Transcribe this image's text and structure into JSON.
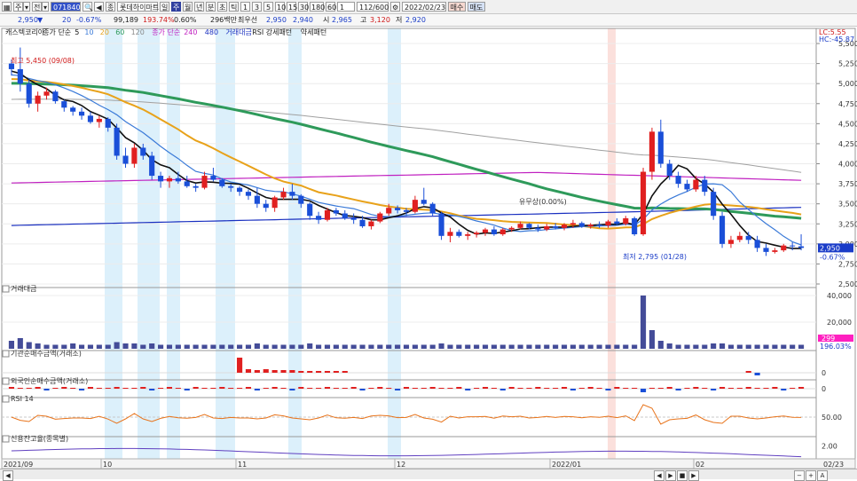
{
  "toolbar": {
    "items": [
      {
        "name": "layout-grid-icon",
        "label": "▦"
      },
      {
        "name": "period-select",
        "label": "주",
        "dropdown": true
      },
      {
        "name": "market-select",
        "label": "전",
        "dropdown": true
      },
      {
        "name": "stock-code-field",
        "label": "071840"
      },
      {
        "name": "search-icon",
        "label": "🔍"
      },
      {
        "name": "prev-stock-button",
        "label": "◀"
      },
      {
        "name": "stock-icon",
        "label": "종"
      },
      {
        "name": "stock-name-field",
        "label": "롯데하이마트"
      },
      {
        "name": "interval-day-button",
        "label": "일"
      },
      {
        "name": "interval-week-button",
        "label": "주"
      },
      {
        "name": "interval-month-button",
        "label": "월"
      },
      {
        "name": "interval-year-button",
        "label": "년"
      },
      {
        "name": "interval-minute-button",
        "label": "분"
      },
      {
        "name": "interval-second-button",
        "label": "초"
      },
      {
        "name": "interval-tick-button",
        "label": "틱"
      },
      {
        "name": "unit-1-button",
        "label": "1"
      },
      {
        "name": "unit-3-button",
        "label": "3"
      },
      {
        "name": "unit-5-button",
        "label": "5"
      },
      {
        "name": "unit-10-button",
        "label": "10"
      },
      {
        "name": "unit-15-button",
        "label": "15"
      },
      {
        "name": "unit-30-button",
        "label": "30"
      },
      {
        "name": "unit-180-button",
        "label": "180"
      },
      {
        "name": "unit-60-button",
        "label": "60"
      },
      {
        "name": "custom-unit-field",
        "label": "1"
      },
      {
        "name": "bar-count-field",
        "label": "112/600"
      },
      {
        "name": "settings-icon",
        "label": "⚙"
      },
      {
        "name": "date-field",
        "label": "2022/02/23"
      },
      {
        "name": "buy-button",
        "label": "매수"
      },
      {
        "name": "sell-button",
        "label": "매도"
      }
    ]
  },
  "quote": {
    "price": "2,950",
    "change_arrow": "▼",
    "change": "20",
    "change_pct": "-0.67%",
    "volume": "99,189",
    "volume_ratio": "193.74%",
    "turnover": "0.60%",
    "market_cap": "296백만",
    "best_bid_label": "최우선",
    "best_ask": "2,950",
    "best_bid": "2,940",
    "open_label": "시",
    "open": "2,965",
    "high_label": "고",
    "high": "3,120",
    "low_label": "저",
    "low": "2,920"
  },
  "legend": {
    "price": "캐스텍코리아",
    "ma_label": "종가 단순",
    "ma_5": "5",
    "ma_10": "10",
    "ma_20": "20",
    "ma_60": "60",
    "ma_120": "120",
    "ma2_label": "종가 단순",
    "ma_240": "240",
    "ma_480": "480",
    "volume": "거래대금",
    "rsi": "RSI 강세패턴",
    "rsi2": "약세패턴"
  },
  "annotations": {
    "high": "최고 5,450 (09/08)",
    "low": "최저 2,795 (01/28)",
    "event": "유무상(0.00%)",
    "lc_label": "LC:5.55",
    "hc_label": "HC:-45.87",
    "last_price": "2,950",
    "last_change": "-0.67%",
    "vol_last": "299",
    "vol_ratio": "196.03%"
  },
  "panes": {
    "volume": "거래대금",
    "inst": "기관순매수금액(거래소)",
    "foreign": "외국인순매수금액(거래소)",
    "rsi": "RSI 14",
    "credit": "신용잔고율(종목별)"
  },
  "axes": {
    "price_ticks": [
      "5,500",
      "5,250",
      "5,000",
      "4,750",
      "4,500",
      "4,250",
      "4,000",
      "3,750",
      "3,500",
      "3,250",
      "3,000",
      "2,750",
      "2,500"
    ],
    "volume_ticks": [
      "40,000",
      "20,000"
    ],
    "inst_ticks": [
      "0"
    ],
    "foreign_ticks": [
      "0"
    ],
    "rsi_ticks": [
      "50.00"
    ],
    "credit_ticks": [
      "2.00"
    ],
    "date_labels": [
      "2021/09",
      "10",
      "11",
      "12",
      "2022/01",
      "02",
      "02/23"
    ]
  },
  "chart_data": {
    "type": "candlestick",
    "ylim": [
      2500,
      5600
    ],
    "candles": [
      [
        5250,
        5300,
        5100,
        5180
      ],
      [
        5180,
        5450,
        4900,
        5000
      ],
      [
        5000,
        5050,
        4700,
        4750
      ],
      [
        4750,
        4900,
        4650,
        4850
      ],
      [
        4850,
        4950,
        4800,
        4900
      ],
      [
        4900,
        4920,
        4750,
        4780
      ],
      [
        4780,
        4800,
        4650,
        4700
      ],
      [
        4700,
        4720,
        4600,
        4650
      ],
      [
        4650,
        4700,
        4550,
        4600
      ],
      [
        4600,
        4650,
        4500,
        4520
      ],
      [
        4520,
        4600,
        4450,
        4560
      ],
      [
        4560,
        4580,
        4400,
        4450
      ],
      [
        4450,
        4500,
        4050,
        4100
      ],
      [
        4100,
        4200,
        3950,
        4000
      ],
      [
        4000,
        4250,
        3950,
        4200
      ],
      [
        4200,
        4250,
        4050,
        4100
      ],
      [
        4100,
        4150,
        3800,
        3850
      ],
      [
        3850,
        3900,
        3700,
        3780
      ],
      [
        3780,
        3850,
        3700,
        3820
      ],
      [
        3820,
        3900,
        3750,
        3780
      ],
      [
        3780,
        3850,
        3700,
        3720
      ],
      [
        3720,
        3750,
        3650,
        3700
      ],
      [
        3700,
        3900,
        3680,
        3850
      ],
      [
        3850,
        3950,
        3780,
        3800
      ],
      [
        3800,
        3820,
        3700,
        3720
      ],
      [
        3720,
        3750,
        3650,
        3700
      ],
      [
        3700,
        3720,
        3600,
        3650
      ],
      [
        3650,
        3680,
        3550,
        3600
      ],
      [
        3600,
        3700,
        3450,
        3500
      ],
      [
        3500,
        3550,
        3400,
        3450
      ],
      [
        3450,
        3600,
        3400,
        3580
      ],
      [
        3580,
        3700,
        3550,
        3650
      ],
      [
        3650,
        3750,
        3550,
        3600
      ],
      [
        3600,
        3620,
        3450,
        3500
      ],
      [
        3500,
        3520,
        3300,
        3350
      ],
      [
        3350,
        3400,
        3250,
        3300
      ],
      [
        3300,
        3450,
        3280,
        3420
      ],
      [
        3420,
        3450,
        3350,
        3380
      ],
      [
        3380,
        3420,
        3300,
        3320
      ],
      [
        3320,
        3380,
        3250,
        3300
      ],
      [
        3300,
        3350,
        3200,
        3220
      ],
      [
        3220,
        3300,
        3180,
        3280
      ],
      [
        3280,
        3400,
        3260,
        3380
      ],
      [
        3380,
        3500,
        3350,
        3450
      ],
      [
        3450,
        3480,
        3380,
        3420
      ],
      [
        3420,
        3450,
        3350,
        3400
      ],
      [
        3400,
        3600,
        3380,
        3550
      ],
      [
        3550,
        3700,
        3480,
        3500
      ],
      [
        3500,
        3520,
        3350,
        3380
      ],
      [
        3380,
        3400,
        3050,
        3100
      ],
      [
        3100,
        3200,
        3020,
        3150
      ],
      [
        3150,
        3180,
        3080,
        3100
      ],
      [
        3100,
        3150,
        3050,
        3120
      ],
      [
        3120,
        3160,
        3080,
        3140
      ],
      [
        3140,
        3200,
        3100,
        3180
      ],
      [
        3180,
        3220,
        3100,
        3120
      ],
      [
        3120,
        3200,
        3100,
        3180
      ],
      [
        3180,
        3220,
        3150,
        3200
      ],
      [
        3200,
        3280,
        3180,
        3250
      ],
      [
        3250,
        3260,
        3180,
        3200
      ],
      [
        3200,
        3240,
        3150,
        3180
      ],
      [
        3180,
        3250,
        3160,
        3220
      ],
      [
        3220,
        3260,
        3180,
        3200
      ],
      [
        3200,
        3260,
        3170,
        3240
      ],
      [
        3240,
        3300,
        3200,
        3260
      ],
      [
        3260,
        3280,
        3200,
        3220
      ],
      [
        3220,
        3260,
        3190,
        3240
      ],
      [
        3240,
        3280,
        3200,
        3230
      ],
      [
        3230,
        3300,
        3200,
        3280
      ],
      [
        3280,
        3320,
        3230,
        3250
      ],
      [
        3250,
        3350,
        3230,
        3320
      ],
      [
        3320,
        3340,
        3100,
        3120
      ],
      [
        3120,
        3950,
        3100,
        3900
      ],
      [
        3900,
        4450,
        3800,
        4400
      ],
      [
        4400,
        4550,
        3950,
        4000
      ],
      [
        4000,
        4050,
        3800,
        3850
      ],
      [
        3850,
        3900,
        3700,
        3750
      ],
      [
        3750,
        3800,
        3650,
        3680
      ],
      [
        3680,
        3850,
        3650,
        3800
      ],
      [
        3800,
        3850,
        3600,
        3650
      ],
      [
        3650,
        3700,
        3300,
        3350
      ],
      [
        3350,
        3400,
        2950,
        3000
      ],
      [
        3000,
        3100,
        2950,
        3050
      ],
      [
        3050,
        3150,
        3020,
        3100
      ],
      [
        3100,
        3150,
        3000,
        3050
      ],
      [
        3050,
        3100,
        2900,
        2950
      ],
      [
        2950,
        3000,
        2850,
        2900
      ],
      [
        2900,
        2950,
        2880,
        2920
      ],
      [
        2920,
        3000,
        2900,
        2980
      ],
      [
        2980,
        3020,
        2920,
        2970
      ],
      [
        2970,
        3120,
        2920,
        2950
      ]
    ],
    "volumes": [
      6,
      8,
      5,
      4,
      3,
      3,
      3,
      4,
      3,
      3,
      3,
      3,
      5,
      4,
      4,
      3,
      4,
      3,
      3,
      3,
      3,
      3,
      3,
      3,
      3,
      3,
      3,
      3,
      4,
      3,
      3,
      3,
      3,
      3,
      4,
      3,
      3,
      3,
      3,
      3,
      3,
      3,
      3,
      3,
      3,
      3,
      3,
      3,
      3,
      4,
      3,
      3,
      3,
      3,
      3,
      3,
      3,
      3,
      3,
      3,
      3,
      3,
      3,
      3,
      3,
      3,
      3,
      3,
      3,
      3,
      3,
      3,
      40,
      14,
      6,
      4,
      3,
      3,
      3,
      3,
      4,
      4,
      3,
      3,
      3,
      3,
      3,
      3,
      3,
      3,
      3
    ]
  }
}
